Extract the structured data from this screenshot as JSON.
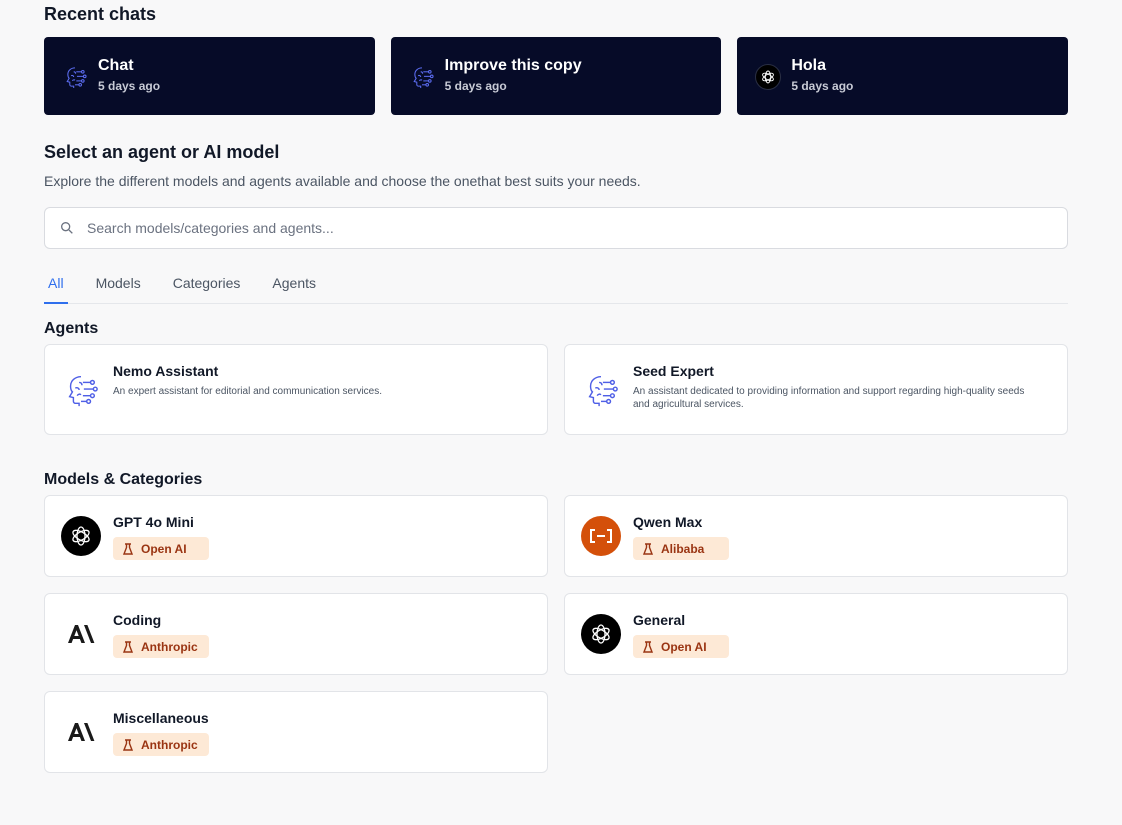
{
  "recent": {
    "title": "Recent chats",
    "items": [
      {
        "name": "Chat",
        "time": "5 days ago",
        "icon": "agent-brain-icon"
      },
      {
        "name": "Improve this copy",
        "time": "5 days ago",
        "icon": "agent-brain-icon"
      },
      {
        "name": "Hola",
        "time": "5 days ago",
        "icon": "openai-logo-icon"
      }
    ]
  },
  "select": {
    "title": "Select an agent or AI model",
    "subtitle": "Explore the different models and agents available and choose the onethat best suits your needs."
  },
  "search": {
    "placeholder": "Search models/categories and agents...",
    "value": ""
  },
  "tabs": [
    {
      "label": "All",
      "active": true
    },
    {
      "label": "Models",
      "active": false
    },
    {
      "label": "Categories",
      "active": false
    },
    {
      "label": "Agents",
      "active": false
    }
  ],
  "agents": {
    "title": "Agents",
    "items": [
      {
        "name": "Nemo Assistant",
        "desc": "An expert assistant for editorial and communication services."
      },
      {
        "name": "Seed Expert",
        "desc": "An assistant dedicated to providing information and support regarding high-quality seeds and agricultural services."
      }
    ]
  },
  "models": {
    "title": "Models & Categories",
    "items": [
      {
        "name": "GPT 4o Mini",
        "provider": "Open AI",
        "icon": "openai-logo-icon"
      },
      {
        "name": "Qwen Max",
        "provider": "Alibaba",
        "icon": "alibaba-logo-icon"
      },
      {
        "name": "Coding",
        "provider": "Anthropic",
        "icon": "anthropic-logo-icon"
      },
      {
        "name": "General",
        "provider": "Open AI",
        "icon": "openai-logo-icon"
      },
      {
        "name": "Miscellaneous",
        "provider": "Anthropic",
        "icon": "anthropic-logo-icon"
      }
    ]
  },
  "colors": {
    "recent_bg": "#060b28",
    "accent": "#2f6fed",
    "badge_bg": "#fde9d6",
    "badge_text": "#9a3412",
    "qwen_bg": "#d4500a"
  }
}
